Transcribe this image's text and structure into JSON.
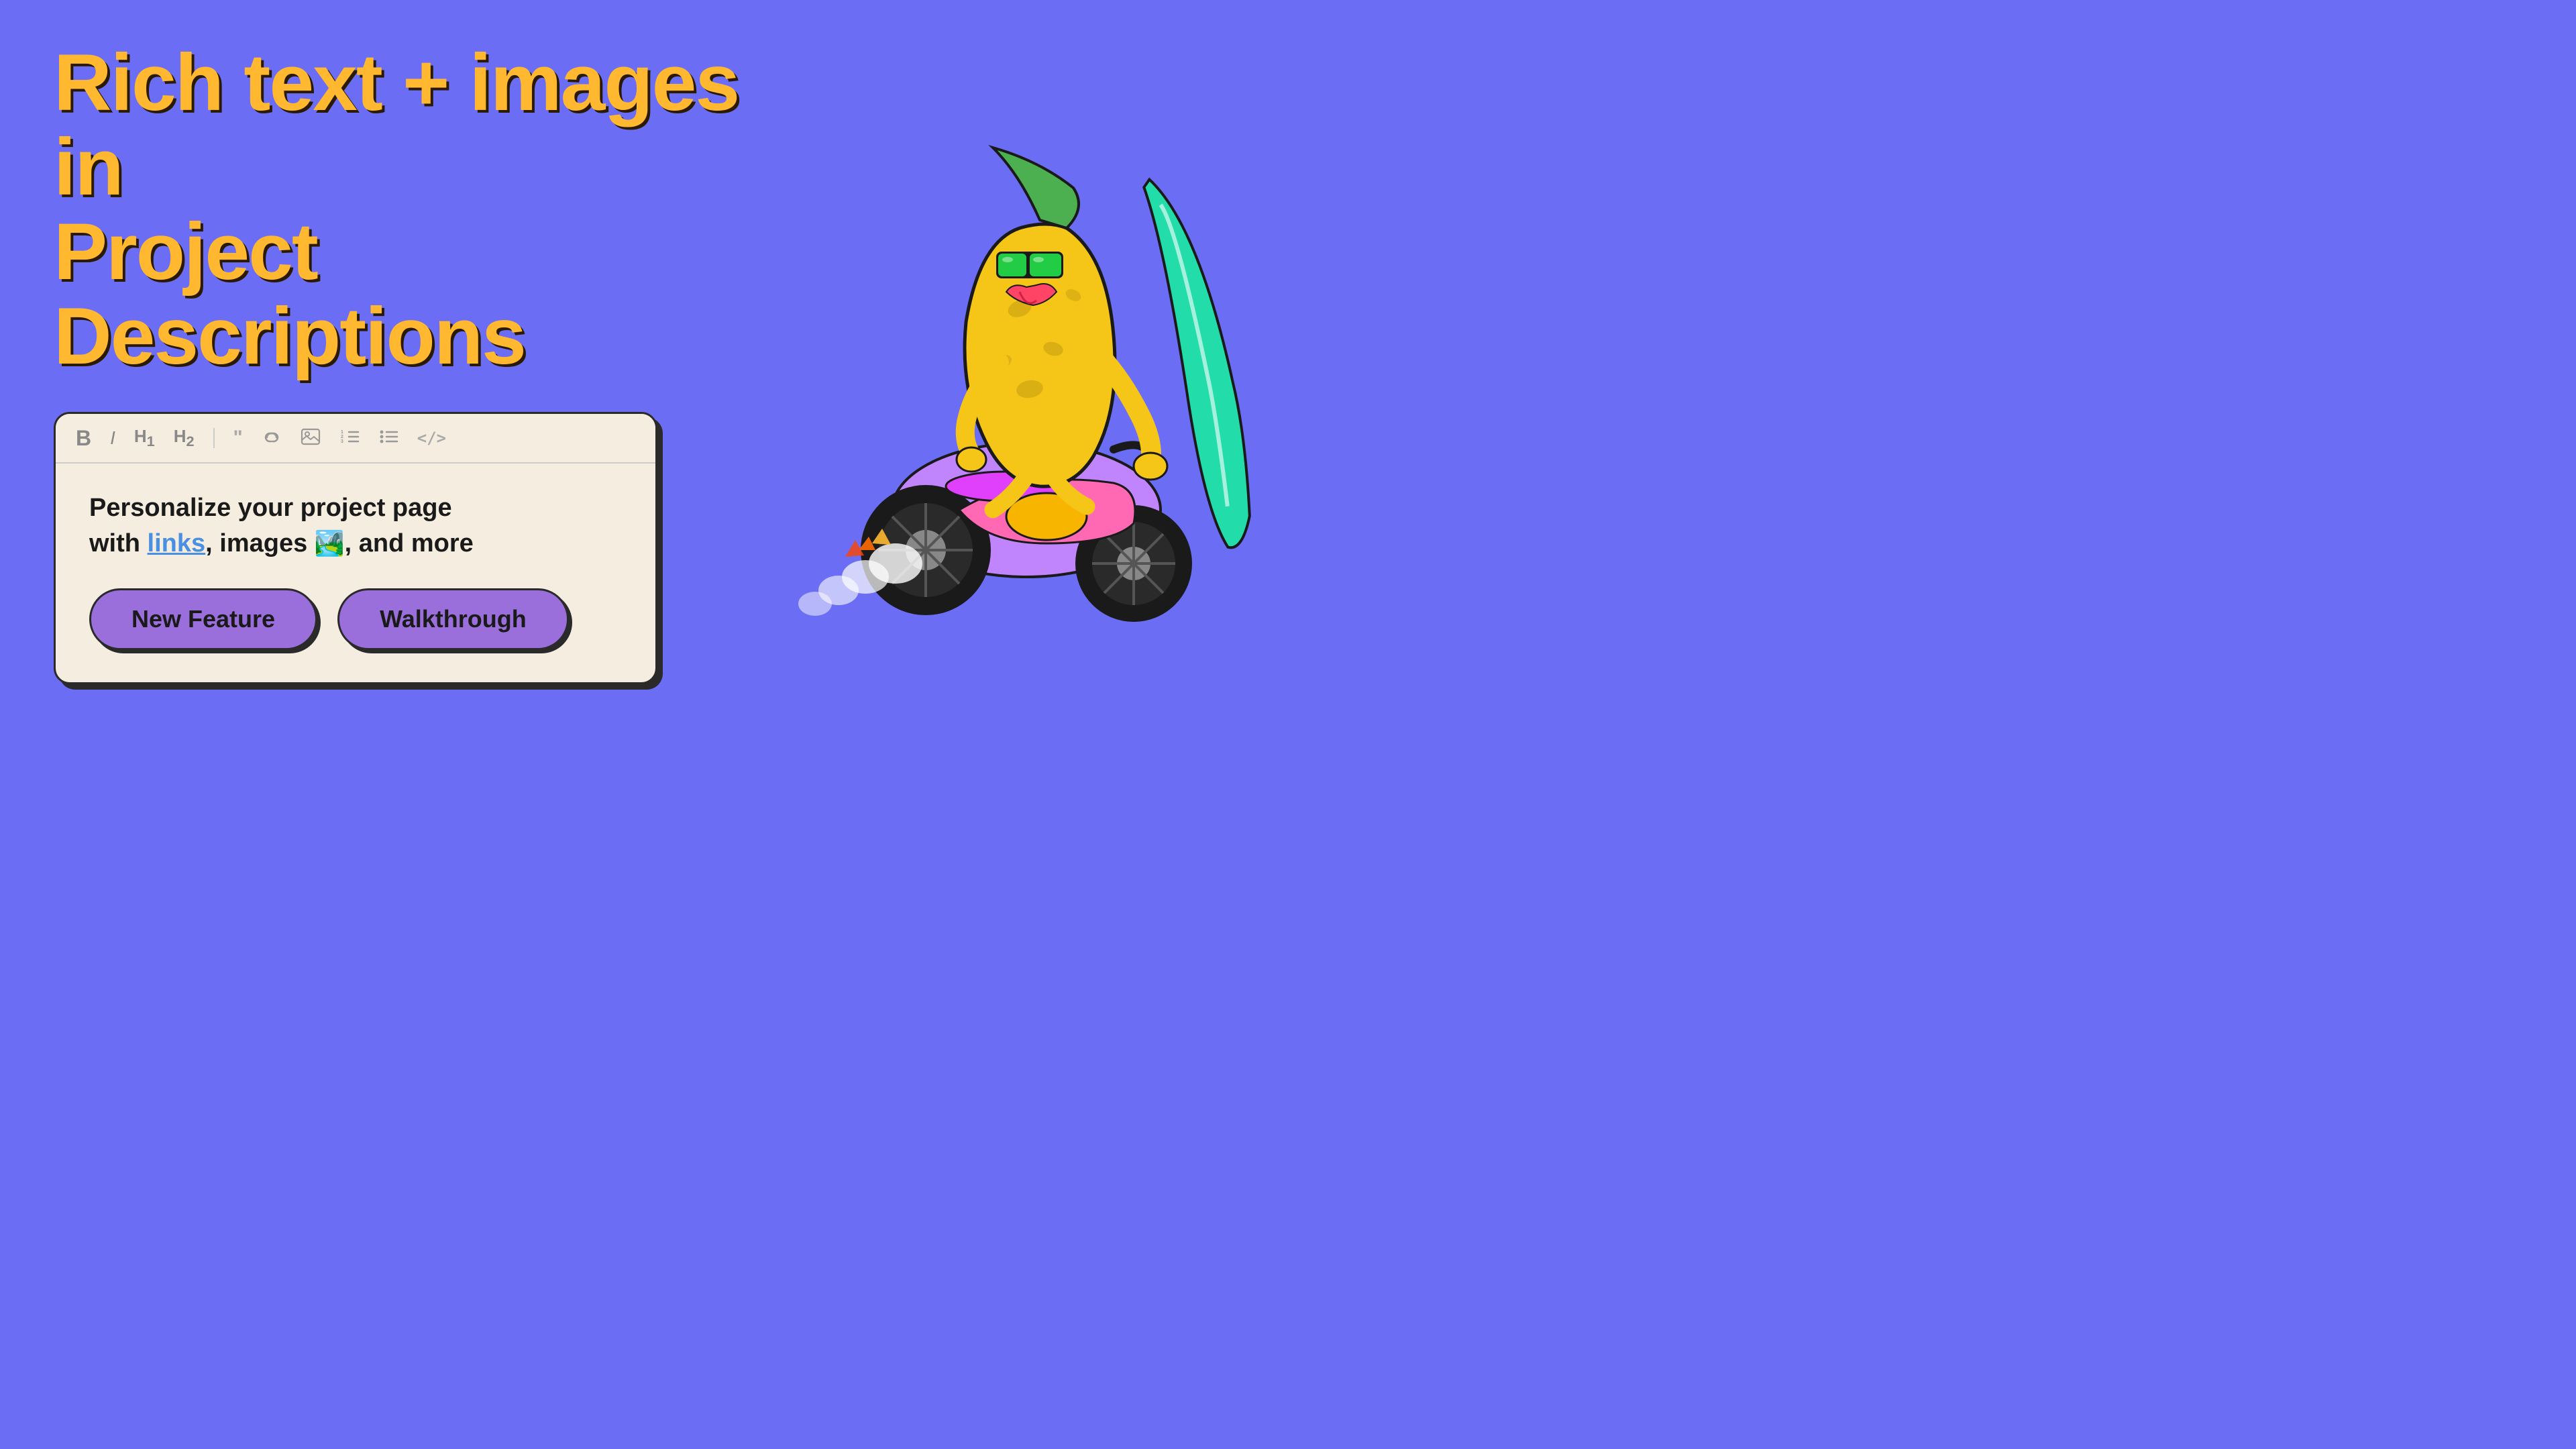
{
  "page": {
    "background_color": "#6b6ef5",
    "headline_line1": "Rich text + images in",
    "headline_line2": "Project Descriptions"
  },
  "toolbar": {
    "icons": [
      {
        "name": "bold",
        "symbol": "B"
      },
      {
        "name": "italic",
        "symbol": "I"
      },
      {
        "name": "h1",
        "symbol": "H₁"
      },
      {
        "name": "h2",
        "symbol": "H₂"
      },
      {
        "name": "blockquote",
        "symbol": "❝"
      },
      {
        "name": "link",
        "symbol": "🔗"
      },
      {
        "name": "image",
        "symbol": "🖼"
      },
      {
        "name": "ordered-list",
        "symbol": "≡"
      },
      {
        "name": "unordered-list",
        "symbol": "☰"
      },
      {
        "name": "code",
        "symbol": "</>"
      }
    ]
  },
  "editor": {
    "text_part1": "Personalize your project page",
    "text_part2": "with ",
    "link_text": "links",
    "text_part3": ", images ",
    "image_emoji": "🏞️",
    "text_part4": ", and more"
  },
  "buttons": [
    {
      "label": "New Feature",
      "name": "new-feature-button"
    },
    {
      "label": "Walkthrough",
      "name": "walkthrough-button"
    }
  ]
}
